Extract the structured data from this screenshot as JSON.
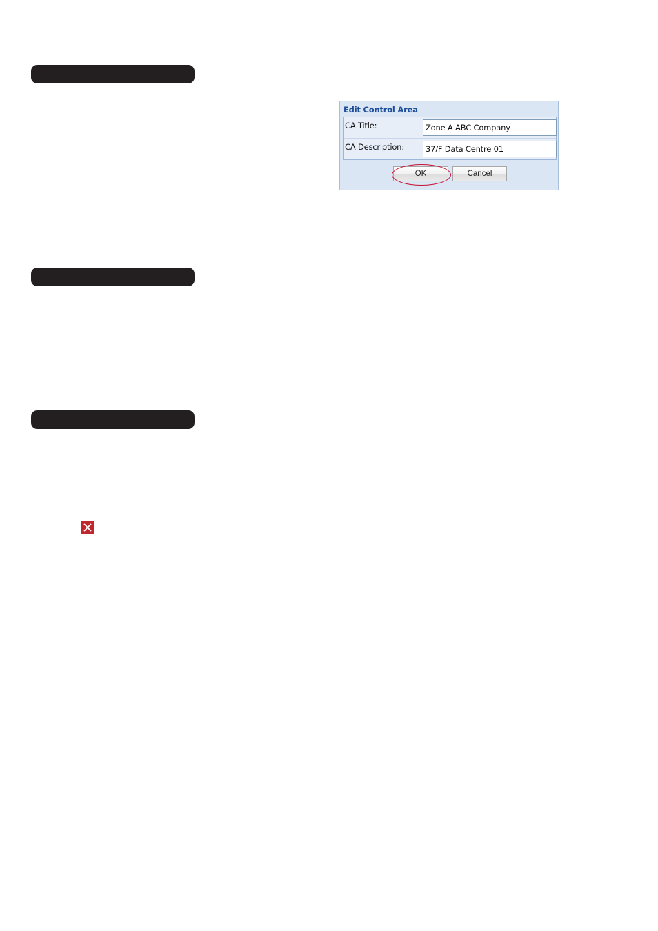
{
  "dialog": {
    "title": "Edit Control Area",
    "fields": [
      {
        "label": "CA Title:",
        "value": "Zone A ABC Company"
      },
      {
        "label": "CA Description:",
        "value": "37/F Data Centre 01"
      }
    ],
    "ok_label": "OK",
    "cancel_label": "Cancel"
  },
  "colors": {
    "section_bar": "#231f20",
    "dialog_title": "#1f4e99",
    "highlight_ring": "#c8102e",
    "close_icon": "#c0272d"
  },
  "icons": {
    "close": "close-icon"
  }
}
